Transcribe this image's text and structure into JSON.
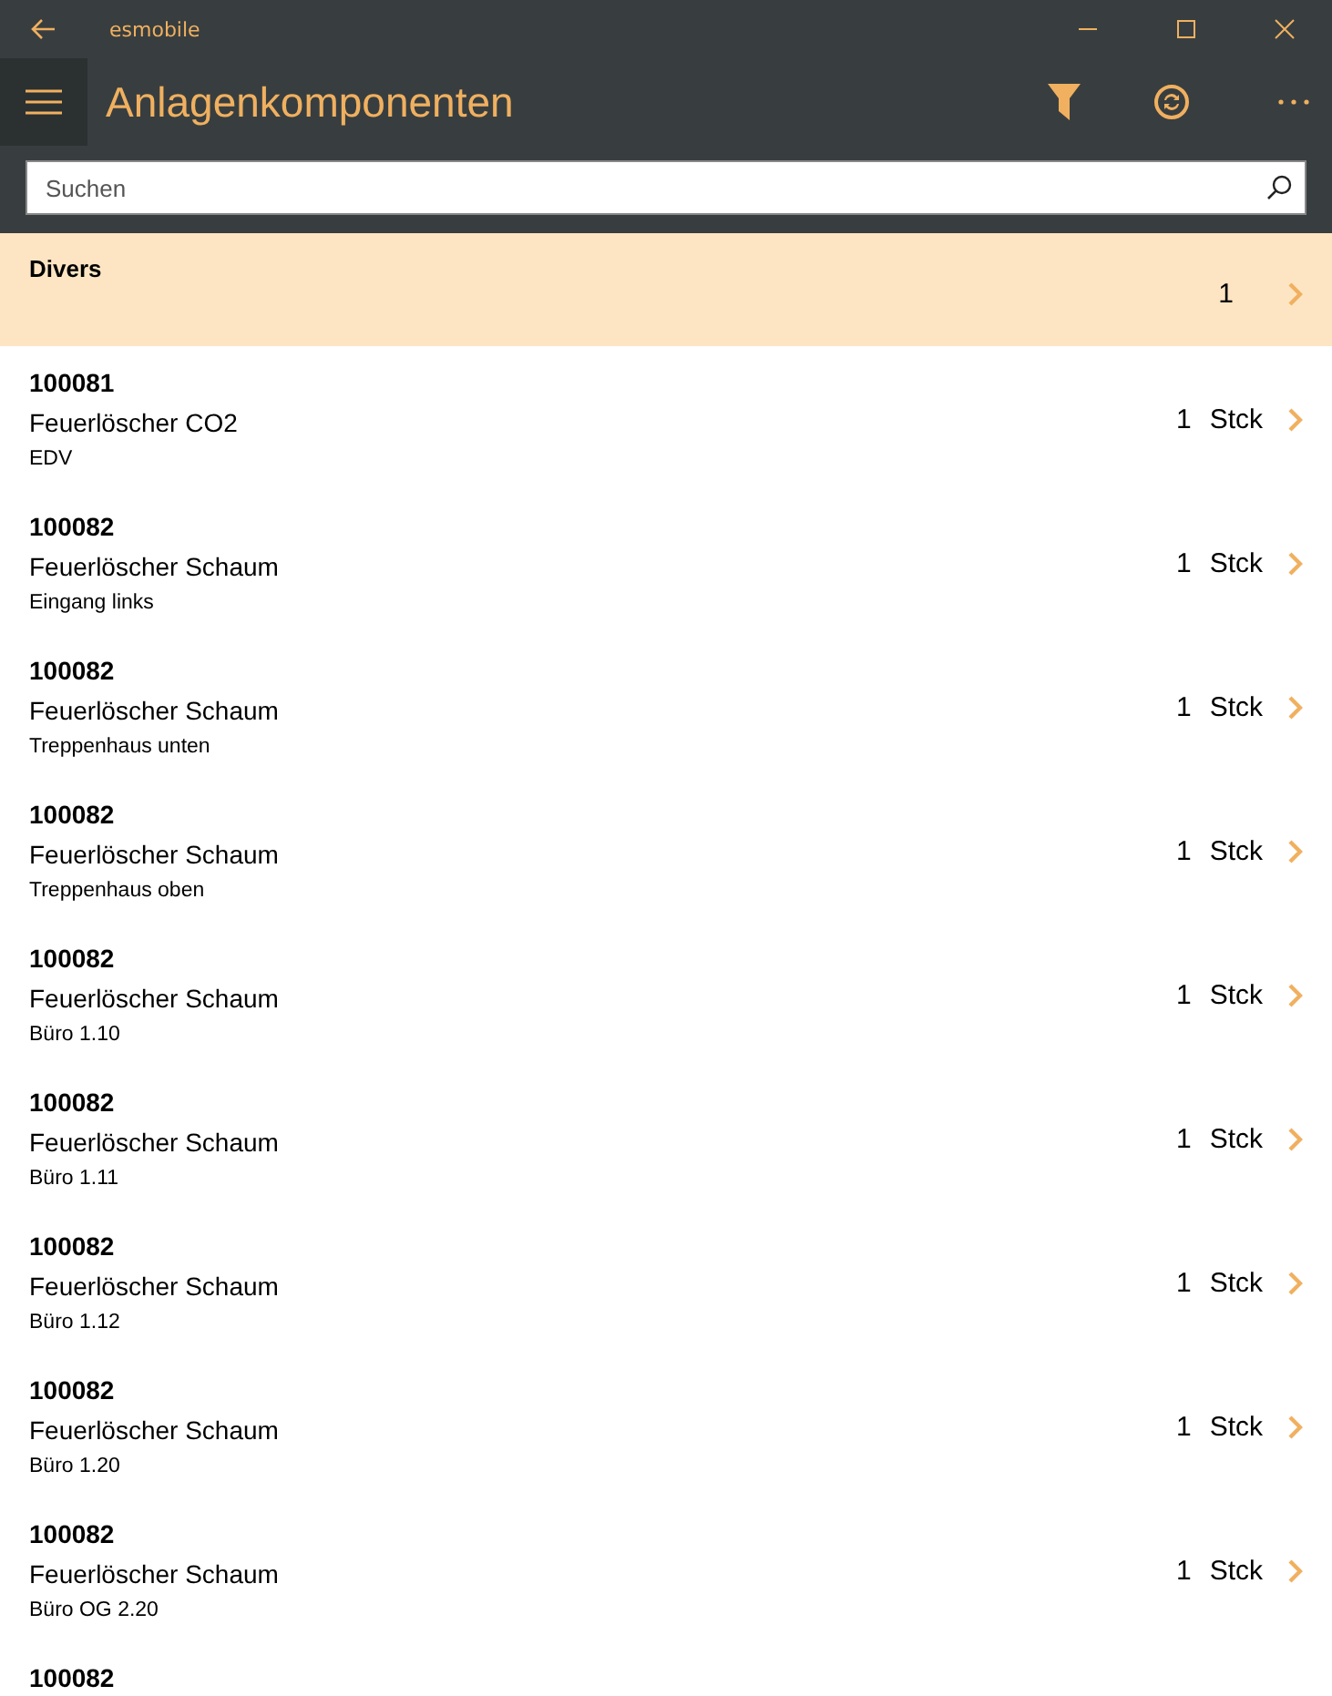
{
  "window": {
    "title": "esmobile"
  },
  "header": {
    "title": "Anlagenkomponenten"
  },
  "search": {
    "placeholder": "Suchen"
  },
  "group": {
    "title": "Divers",
    "count": "1"
  },
  "rows": [
    {
      "code": "100081",
      "name": "Feuerlöscher CO2",
      "location": "EDV",
      "qty": "1",
      "unit": "Stck"
    },
    {
      "code": "100082",
      "name": "Feuerlöscher Schaum",
      "location": "Eingang links",
      "qty": "1",
      "unit": "Stck"
    },
    {
      "code": "100082",
      "name": "Feuerlöscher Schaum",
      "location": "Treppenhaus unten",
      "qty": "1",
      "unit": "Stck"
    },
    {
      "code": "100082",
      "name": "Feuerlöscher Schaum",
      "location": "Treppenhaus oben",
      "qty": "1",
      "unit": "Stck"
    },
    {
      "code": "100082",
      "name": "Feuerlöscher Schaum",
      "location": "Büro 1.10",
      "qty": "1",
      "unit": "Stck"
    },
    {
      "code": "100082",
      "name": "Feuerlöscher Schaum",
      "location": "Büro 1.11",
      "qty": "1",
      "unit": "Stck"
    },
    {
      "code": "100082",
      "name": "Feuerlöscher Schaum",
      "location": "Büro 1.12",
      "qty": "1",
      "unit": "Stck"
    },
    {
      "code": "100082",
      "name": "Feuerlöscher Schaum",
      "location": "Büro 1.20",
      "qty": "1",
      "unit": "Stck"
    },
    {
      "code": "100082",
      "name": "Feuerlöscher Schaum",
      "location": "Büro OG 2.20",
      "qty": "1",
      "unit": "Stck"
    },
    {
      "code": "100082"
    }
  ]
}
